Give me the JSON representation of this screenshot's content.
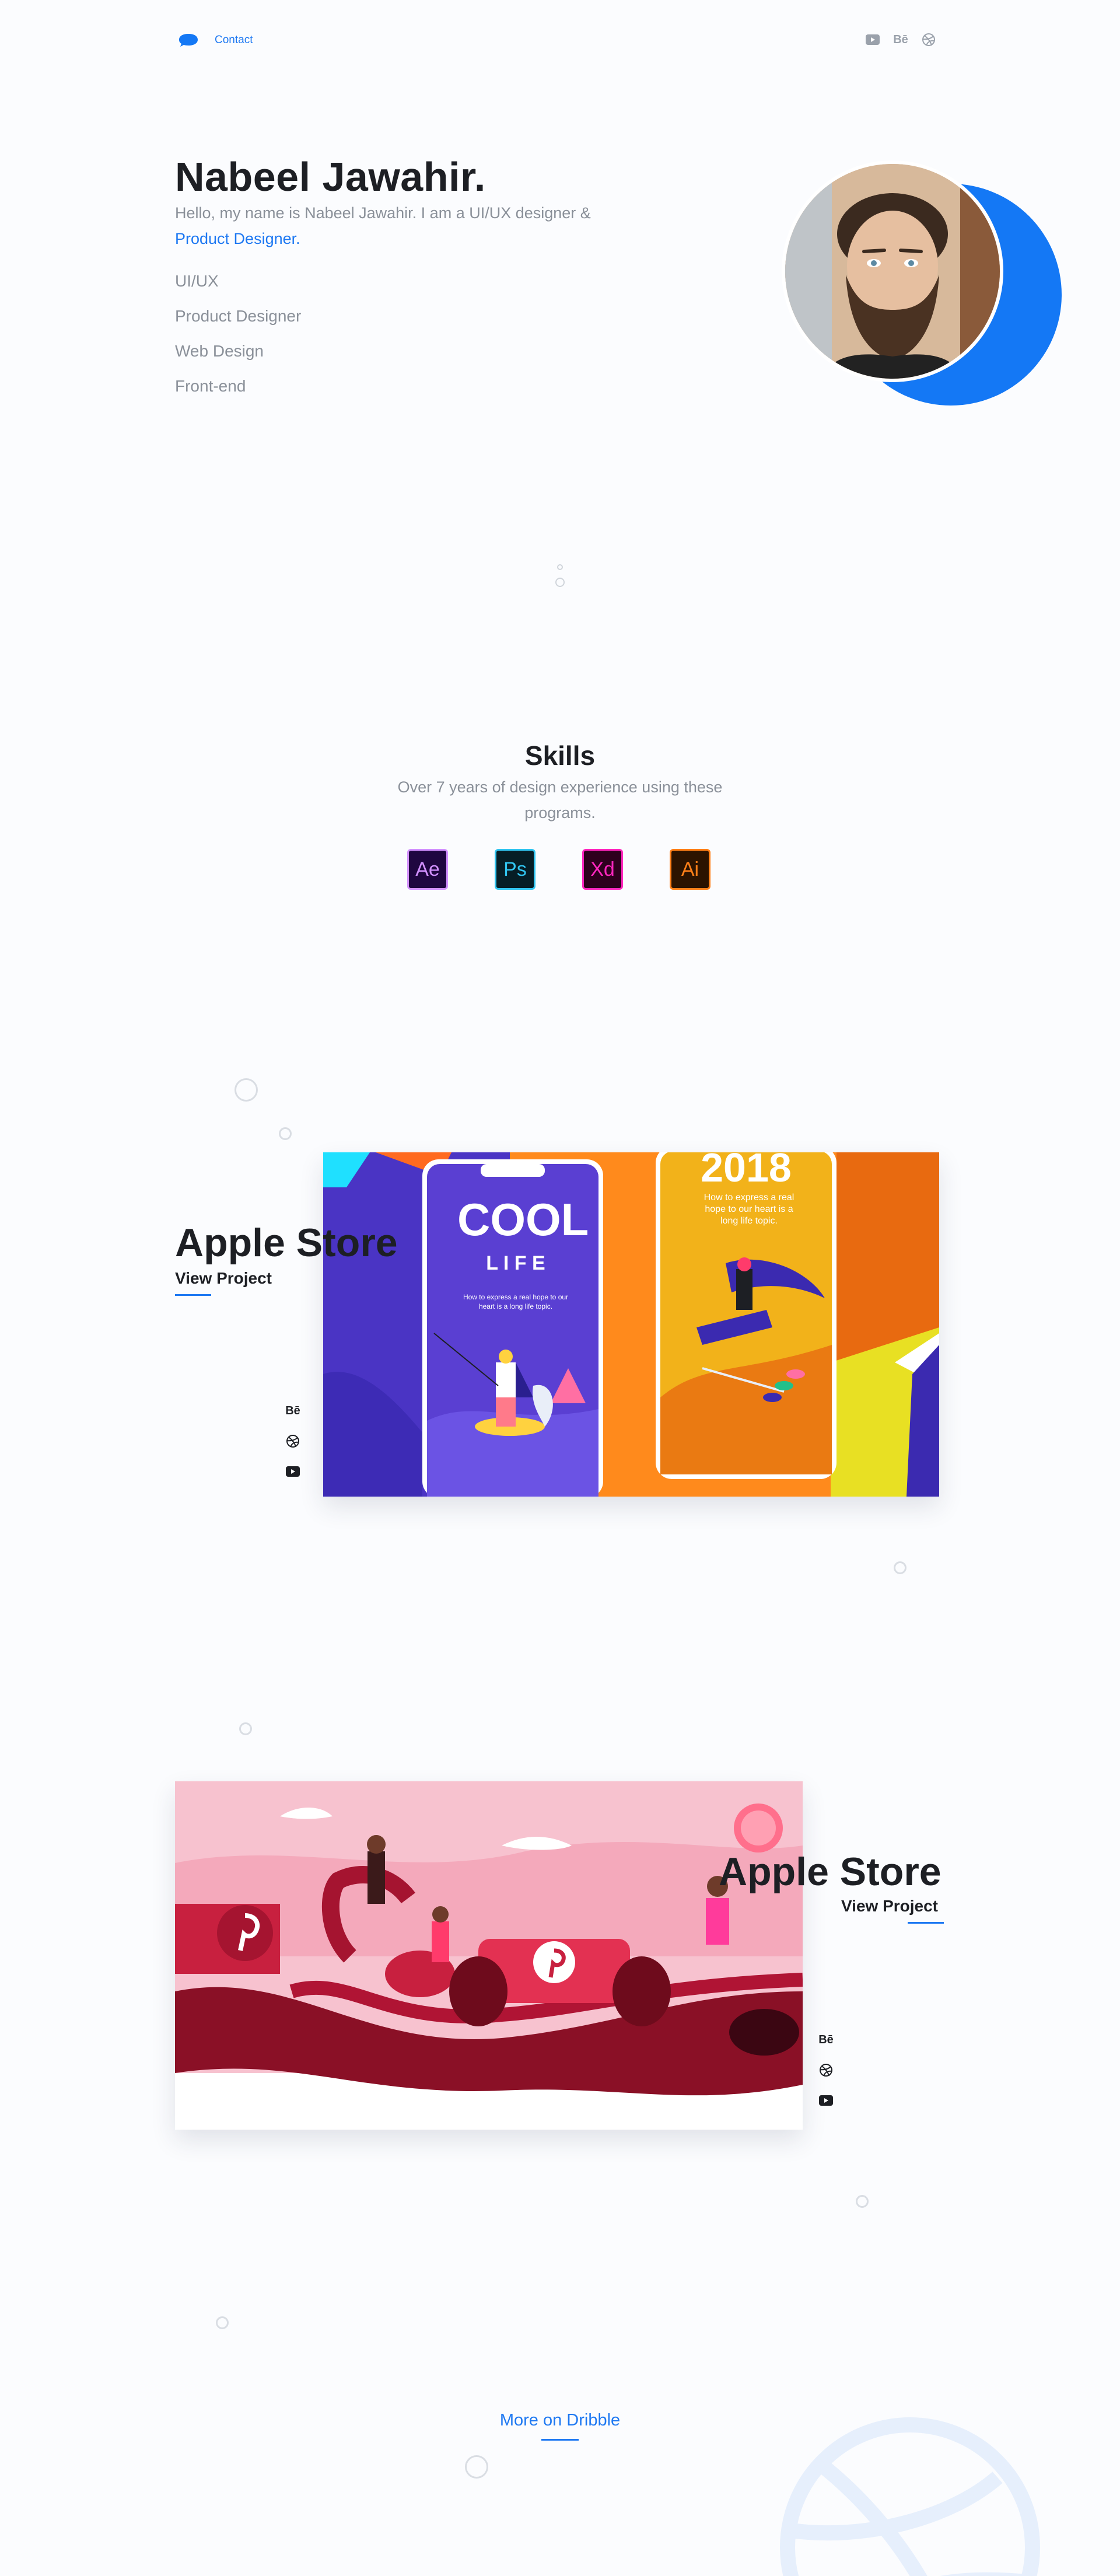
{
  "header": {
    "contact_label": "Contact",
    "icons": [
      "youtube-icon",
      "behance-icon",
      "dribbble-icon"
    ],
    "behance_text": "Bē"
  },
  "hero": {
    "name": "Nabeel Jawahir.",
    "intro": "Hello, my name is Nabeel Jawahir. I am a UI/UX designer & ",
    "intro_accent": "Product Designer.",
    "roles": [
      "UI/UX",
      "Product Designer",
      "Web Design",
      "Front-end"
    ]
  },
  "skills": {
    "title": "Skills",
    "description": "Over 7 years of design experience using these programs.",
    "programs": [
      {
        "abbr": "Ae",
        "bg": "#1f0740",
        "fg": "#d291ff"
      },
      {
        "abbr": "Ps",
        "bg": "#061e26",
        "fg": "#31c5f0"
      },
      {
        "abbr": "Xd",
        "bg": "#2e001e",
        "fg": "#ff26be"
      },
      {
        "abbr": "Ai",
        "bg": "#2c1300",
        "fg": "#ff7f18"
      }
    ]
  },
  "projects": [
    {
      "title": "Apple Store",
      "link_label": "View Project",
      "card_text": {
        "cool": "COOL",
        "life": "L I F E",
        "year": "2018",
        "caption_left": "How to express a real hope to our heart is a long life topic.",
        "caption_right": "How to express a real hope to our heart is a long life topic."
      },
      "social": [
        "behance-icon",
        "dribbble-icon",
        "youtube-icon"
      ]
    },
    {
      "title": "Apple Store",
      "link_label": "View Project",
      "social": [
        "behance-icon",
        "dribbble-icon",
        "youtube-icon"
      ]
    }
  ],
  "footer": {
    "more_label": "More on Dribble"
  },
  "colors": {
    "accent": "#1d78f2",
    "moon": "#1478f5",
    "muted_text": "#8a9099"
  }
}
